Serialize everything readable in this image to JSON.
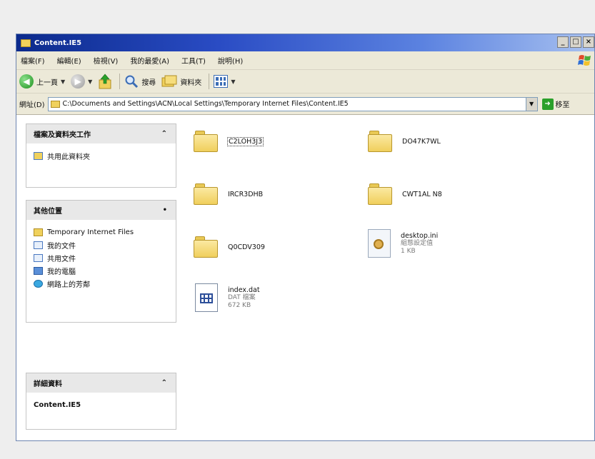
{
  "window": {
    "title": "Content.IE5"
  },
  "menu": [
    "檔案(F)",
    "編輯(E)",
    "檢視(V)",
    "我的最愛(A)",
    "工具(T)",
    "說明(H)"
  ],
  "toolbar": {
    "back_label": "上一頁",
    "search_label": "搜尋",
    "folders_label": "資料夾"
  },
  "address": {
    "label": "網址(D)",
    "path": "C:\\Documents and Settings\\ACN\\Local Settings\\Temporary Internet Files\\Content.IE5",
    "go_label": "移至"
  },
  "panels": {
    "file_tasks": {
      "title": "檔案及資料夾工作",
      "items": [
        "共用此資料夾"
      ]
    },
    "other_places": {
      "title": "其他位置",
      "items": [
        "Temporary Internet Files",
        "我的文件",
        "共用文件",
        "我的電腦",
        "網路上的芳鄰"
      ]
    },
    "details": {
      "title": "詳細資料",
      "name": "Content.IE5"
    }
  },
  "files": {
    "folder1": "C2LOH3J3",
    "folder2": "DO47K7WL",
    "folder3": "IRCR3DHB",
    "folder4": "CWT1AL N8",
    "folder5": "Q0CDV309",
    "desktop_ini": {
      "name": "desktop.ini",
      "type": "組態設定值",
      "size": "1 KB"
    },
    "index_dat": {
      "name": "index.dat",
      "type": "DAT 檔案",
      "size": "672 KB"
    }
  }
}
